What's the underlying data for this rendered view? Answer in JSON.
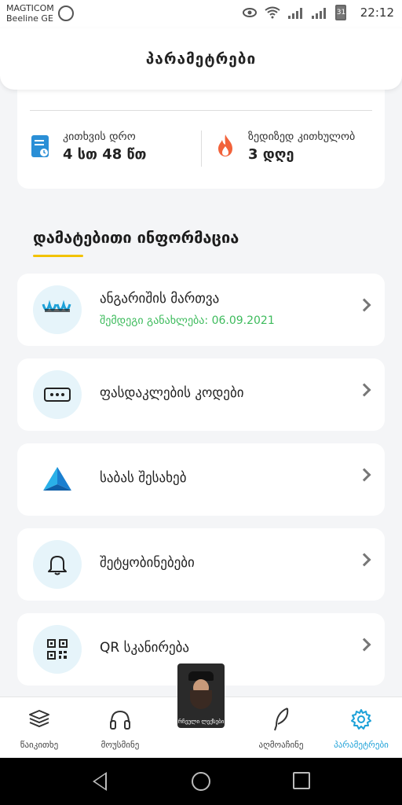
{
  "status_bar": {
    "carrier_1": "MAGTICOM",
    "carrier_2": "Beeline GE",
    "battery": "31",
    "time": "22:12"
  },
  "header": {
    "title": "პარამეტრები"
  },
  "stats": {
    "reading_time": {
      "label": "კითხვის დრო",
      "value": "4 სთ 48 წთ"
    },
    "streak": {
      "label": "ზედიზედ კითხულობ",
      "value": "3 დღე"
    }
  },
  "section": {
    "title": "დამატებითი ინფორმაცია"
  },
  "menu": {
    "account": {
      "label": "ანგარიშის მართვა",
      "sublabel": "შემდეგი განახლება: 06.09.2021"
    },
    "promo_codes": {
      "label": "ფასდაკლების კოდები"
    },
    "about": {
      "label": "საბას შესახებ"
    },
    "notifications": {
      "label": "შეტყობინებები"
    },
    "qr": {
      "label": "QR სკანირება"
    }
  },
  "floating_book": {
    "caption": "რჩეული ლექსები"
  },
  "bottom_nav": {
    "read": "წაიკითხე",
    "listen": "მოუსმინე",
    "discover": "აღმოაჩინე",
    "settings": "პარამეტრები"
  },
  "colors": {
    "accent": "#1da1d8",
    "underline": "#f2c200",
    "success_text": "#3dbb5c",
    "icon_circle_bg": "#e6f4fa"
  }
}
